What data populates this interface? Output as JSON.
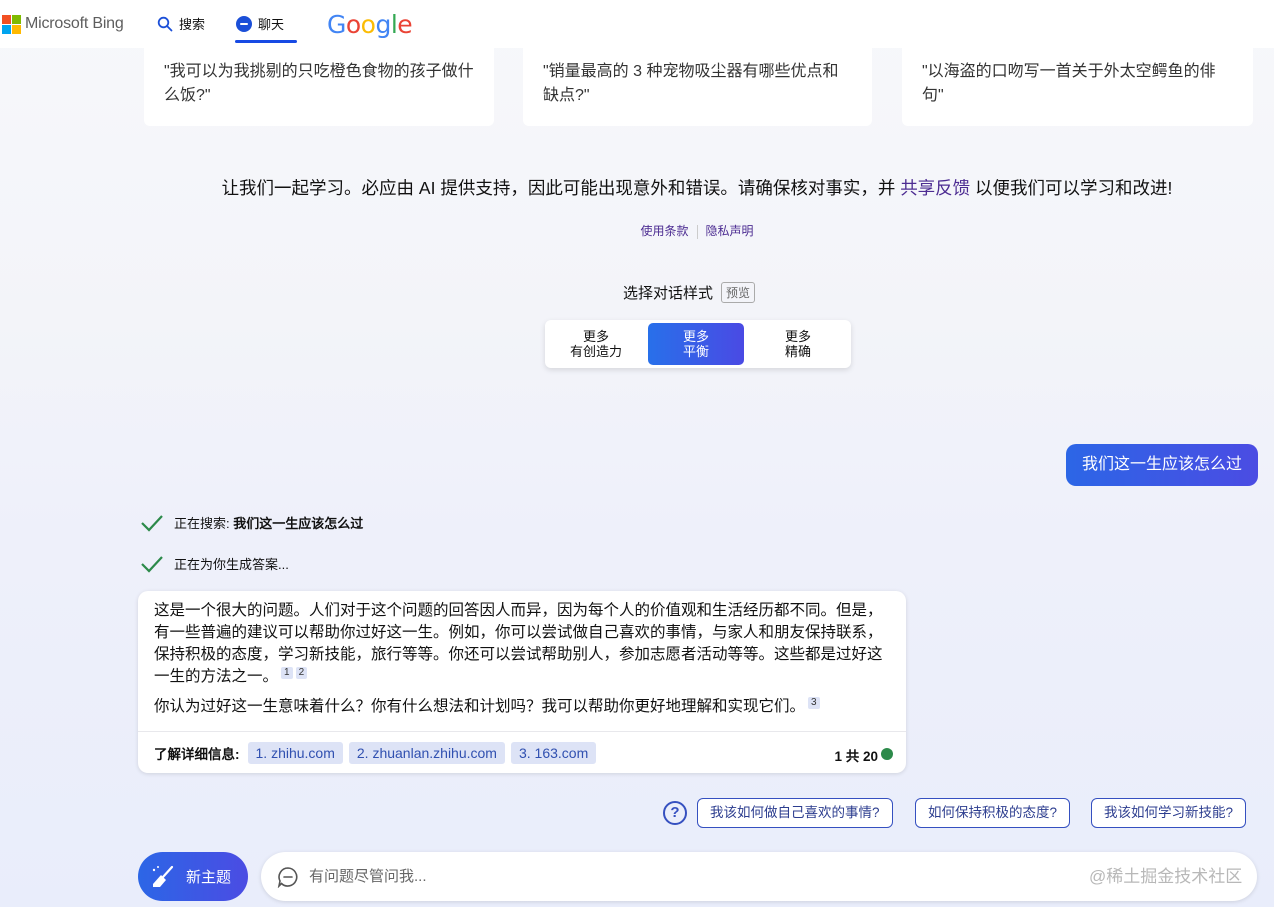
{
  "header": {
    "brand": "Microsoft Bing",
    "nav_search": "搜索",
    "nav_chat": "聊天",
    "google_logo": "Google",
    "ms_colors": [
      "#f25022",
      "#7fba00",
      "#00a4ef",
      "#ffb900"
    ],
    "google_colors": [
      "#4285f4",
      "#ea4335",
      "#fbbc05",
      "#4285f4",
      "#34a853",
      "#ea4335"
    ]
  },
  "examples": [
    "\"我可以为我挑剔的只吃橙色食物的孩子做什么饭?\"",
    "\"销量最高的 3 种宠物吸尘器有哪些优点和缺点?\"",
    "\"以海盗的口吻写一首关于外太空鳄鱼的俳句\""
  ],
  "disclaimer": {
    "before": "让我们一起学习。必应由 AI 提供支持，因此可能出现意外和错误。请确保核对事实，并 ",
    "link": "共享反馈",
    "after": " 以便我们可以学习和改进!"
  },
  "legal_links": {
    "terms": "使用条款",
    "privacy": "隐私声明"
  },
  "tone": {
    "title": "选择对话样式",
    "badge": "预览",
    "options": [
      {
        "line1": "更多",
        "line2": "有创造力"
      },
      {
        "line1": "更多",
        "line2": "平衡"
      },
      {
        "line1": "更多",
        "line2": "精确"
      }
    ],
    "active_index": 1,
    "accent": "#2870ea"
  },
  "user_message": "我们这一生应该怎么过",
  "progress": {
    "search_prefix": "正在搜索: ",
    "search_query": "我们这一生应该怎么过",
    "generating": "正在为你生成答案..."
  },
  "answer": {
    "para1": "这是一个很大的问题。人们对于这个问题的回答因人而异，因为每个人的价值观和生活经历都不同。但是，有一些普遍的建议可以帮助你过好这一生。例如，你可以尝试做自己喜欢的事情，与家人和朋友保持联系，保持积极的态度，学习新技能，旅行等等。你还可以尝试帮助别人，参加志愿者活动等等。这些都是过好这一生的方法之一。",
    "para1_cites": [
      "1",
      "2"
    ],
    "para2": "你认为过好这一生意味着什么？你有什么想法和计划吗？我可以帮助你更好地理解和实现它们。",
    "para2_cites": [
      "3"
    ],
    "learn_more": "了解详细信息:",
    "sources": [
      "1. zhihu.com",
      "2. zhuanlan.zhihu.com",
      "3. 163.com"
    ],
    "page_count": "1 共 20",
    "status_color": "#2c8a4a"
  },
  "suggestions": [
    "我该如何做自己喜欢的事情?",
    "如何保持积极的态度?",
    "我该如何学习新技能?"
  ],
  "bottom": {
    "new_topic": "新主题",
    "input_placeholder": "有问题尽管问我...",
    "watermark": "@稀土掘金技术社区"
  }
}
